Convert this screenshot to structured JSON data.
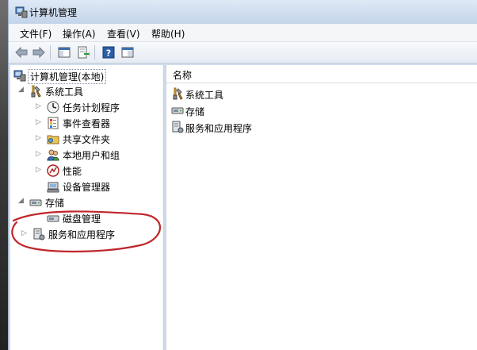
{
  "window": {
    "title": "计算机管理"
  },
  "menu": [
    {
      "label": "文件(F)",
      "name": "menu-file"
    },
    {
      "label": "操作(A)",
      "name": "menu-action"
    },
    {
      "label": "查看(V)",
      "name": "menu-view"
    },
    {
      "label": "帮助(H)",
      "name": "menu-help"
    }
  ],
  "toolbar": {
    "buttons": [
      "back-icon",
      "forward-icon",
      "show-hide-console-tree-icon",
      "export-list-icon",
      "help-icon",
      "properties-icon"
    ]
  },
  "tree": {
    "root": "计算机管理(本地)",
    "system_tools": {
      "label": "系统工具",
      "children": [
        "任务计划程序",
        "事件查看器",
        "共享文件夹",
        "本地用户和组",
        "性能",
        "设备管理器"
      ]
    },
    "storage": {
      "label": "存储",
      "children": [
        "磁盘管理"
      ]
    },
    "services": {
      "label": "服务和应用程序"
    }
  },
  "list": {
    "column_header": "名称",
    "items": [
      {
        "label": "系统工具",
        "icon": "system-tools-icon"
      },
      {
        "label": "存储",
        "icon": "storage-icon"
      },
      {
        "label": "服务和应用程序",
        "icon": "services-applications-icon"
      }
    ]
  },
  "annotation": {
    "color": "#c0262c"
  }
}
